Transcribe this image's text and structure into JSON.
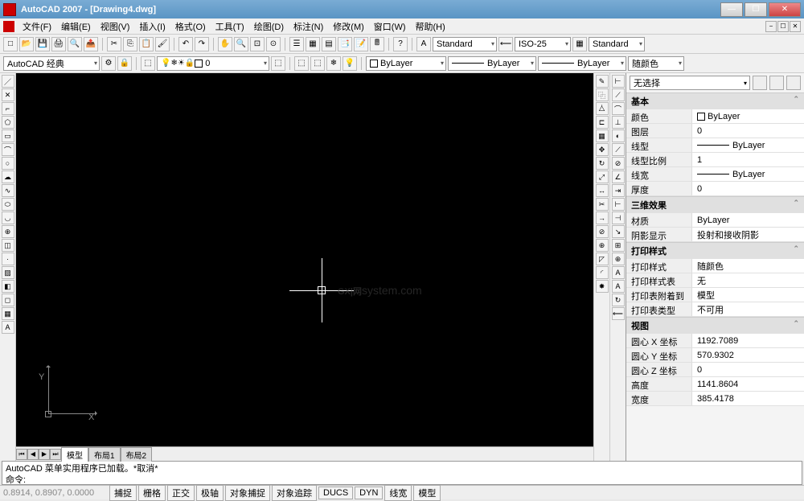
{
  "window": {
    "title": "AutoCAD 2007 - [Drawing4.dwg]",
    "min": "—",
    "max": "☐",
    "close": "✕"
  },
  "menu": {
    "items": [
      "文件(F)",
      "编辑(E)",
      "视图(V)",
      "插入(I)",
      "格式(O)",
      "工具(T)",
      "绘图(D)",
      "标注(N)",
      "修改(M)",
      "窗口(W)",
      "帮助(H)"
    ]
  },
  "toolbar1": {
    "style1": "Standard",
    "style2": "ISO-25",
    "style3": "Standard"
  },
  "toolbar2": {
    "workspace": "AutoCAD 经典",
    "layer": "0",
    "color": "ByLayer",
    "linetype": "ByLayer",
    "lineweight": "ByLayer",
    "plotcolor": "随颜色"
  },
  "tabs": {
    "model": "模型",
    "layout1": "布局1",
    "layout2": "布局2"
  },
  "props": {
    "selector": "无选择",
    "sections": {
      "basic": {
        "title": "基本",
        "color_label": "颜色",
        "color_value": "ByLayer",
        "layer_label": "图层",
        "layer_value": "0",
        "linetype_label": "线型",
        "linetype_value": "ByLayer",
        "ltscale_label": "线型比例",
        "ltscale_value": "1",
        "lineweight_label": "线宽",
        "lineweight_value": "ByLayer",
        "thickness_label": "厚度",
        "thickness_value": "0"
      },
      "threed": {
        "title": "三维效果",
        "material_label": "材质",
        "material_value": "ByLayer",
        "shadow_label": "阴影显示",
        "shadow_value": "投射和接收阴影"
      },
      "plot": {
        "title": "打印样式",
        "style_label": "打印样式",
        "style_value": "随颜色",
        "table_label": "打印样式表",
        "table_value": "无",
        "attach_label": "打印表附着到",
        "attach_value": "模型",
        "type_label": "打印表类型",
        "type_value": "不可用"
      },
      "view": {
        "title": "视图",
        "cx_label": "圆心 X 坐标",
        "cx_value": "1192.7089",
        "cy_label": "圆心 Y 坐标",
        "cy_value": "570.9302",
        "cz_label": "圆心 Z 坐标",
        "cz_value": "0",
        "h_label": "高度",
        "h_value": "1141.8604",
        "w_label": "宽度",
        "w_value": "385.4178"
      }
    }
  },
  "cmd": {
    "line1": "AutoCAD 菜单实用程序已加载。*取消*",
    "line2": "命令:"
  },
  "status": {
    "coords": "0.8914, 0.8907, 0.0000",
    "buttons": [
      "捕捉",
      "栅格",
      "正交",
      "极轴",
      "对象捕捉",
      "对象追踪",
      "DUCS",
      "DYN",
      "线宽",
      "模型"
    ]
  },
  "ucs": {
    "x": "X",
    "y": "Y"
  },
  "watermark": {
    "main": "GX|网",
    "sub": "system.com"
  }
}
